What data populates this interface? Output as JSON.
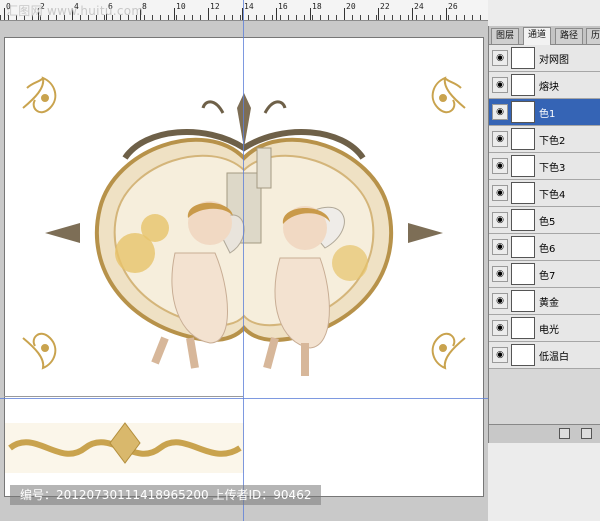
{
  "app": {
    "watermark": "汇图网 www.huitu.com"
  },
  "ruler": {
    "labels": [
      "0",
      "2",
      "4",
      "6",
      "8",
      "10",
      "12",
      "14",
      "16",
      "18",
      "20",
      "22",
      "24",
      "26"
    ]
  },
  "layers_panel": {
    "tabs": [
      {
        "label": "图层",
        "active": false
      },
      {
        "label": "通道",
        "active": true
      },
      {
        "label": "路径",
        "active": false
      },
      {
        "label": "历",
        "active": false
      }
    ],
    "items": [
      {
        "name": "对网图",
        "selected": false
      },
      {
        "name": "熔块",
        "selected": false
      },
      {
        "name": "色1",
        "selected": true
      },
      {
        "name": "下色2",
        "selected": false
      },
      {
        "name": "下色3",
        "selected": false
      },
      {
        "name": "下色4",
        "selected": false
      },
      {
        "name": "色5",
        "selected": false
      },
      {
        "name": "色6",
        "selected": false
      },
      {
        "name": "色7",
        "selected": false
      },
      {
        "name": "黄金",
        "selected": false
      },
      {
        "name": "电光",
        "selected": false
      },
      {
        "name": "低温白",
        "selected": false
      }
    ]
  },
  "caption": "编号：20120730111418965200 上传者ID：90462",
  "colors": {
    "gold": "#c9a34e",
    "selection": "#3564b5",
    "guide": "#5e7fd8"
  }
}
